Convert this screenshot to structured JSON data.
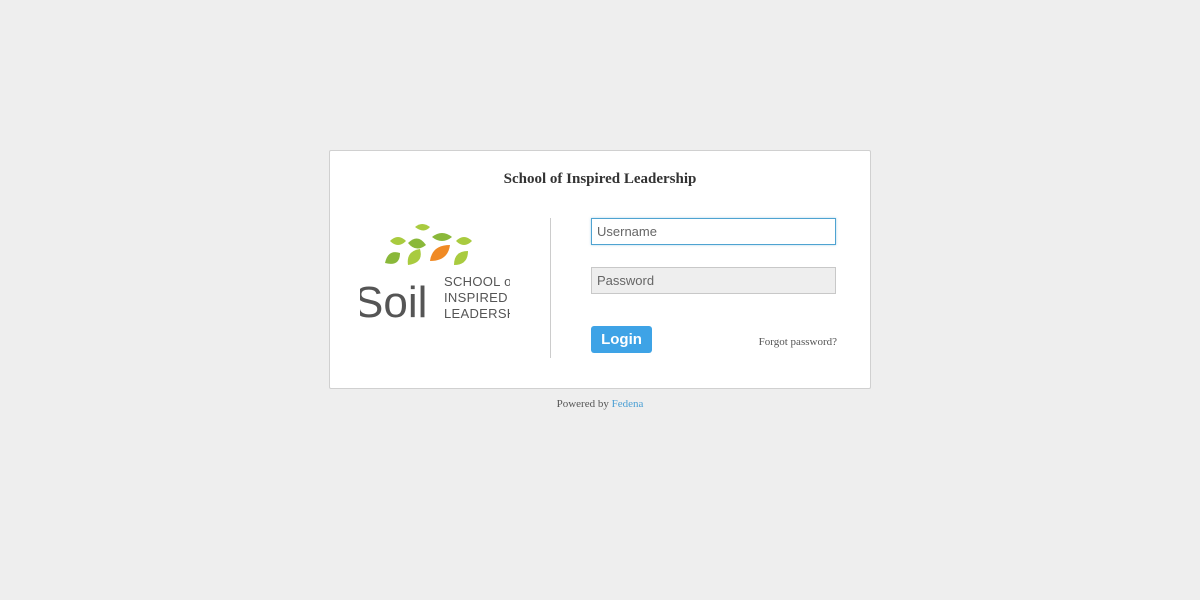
{
  "login": {
    "school_name": "School of Inspired Leadership",
    "username_placeholder": "Username",
    "password_placeholder": "Password",
    "login_label": "Login",
    "forgot_password_label": "Forgot password?"
  },
  "logo": {
    "wordmark": "Soil",
    "lines": [
      "SCHOOL of",
      "INSPIRED",
      "LEADERSHIP"
    ],
    "colors": {
      "leaf_light": "#a9cb3f",
      "leaf_dark": "#8ab83a",
      "leaf_orange": "#f08a24",
      "text": "#555555"
    }
  },
  "footer": {
    "powered_by": "Powered by",
    "brand": "Fedena"
  },
  "colors": {
    "background": "#eeeeee",
    "accent": "#3ea3e6",
    "link": "#4a9fd4"
  }
}
